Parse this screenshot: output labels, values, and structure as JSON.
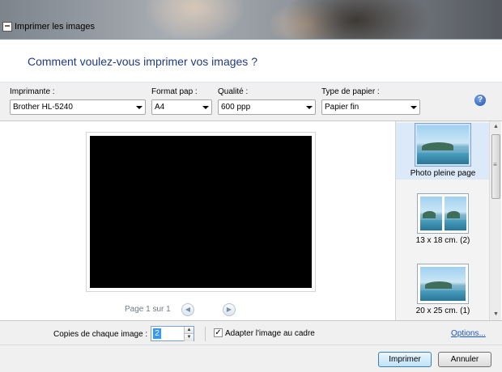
{
  "window": {
    "title": "Imprimer les images",
    "close_glyph": "✕"
  },
  "header": {
    "question": "Comment voulez-vous imprimer vos images ?"
  },
  "options": {
    "printer_label": "Imprimante :",
    "printer_value": "Brother HL-5240",
    "format_label": "Format pap :",
    "format_value": "A4",
    "quality_label": "Qualité :",
    "quality_value": "600 ppp",
    "paper_type_label": "Type de papier :",
    "paper_type_value": "Papier fin",
    "help_glyph": "?"
  },
  "preview": {
    "page_text": "Page 1 sur 1",
    "prev_glyph": "◀",
    "next_glyph": "▶"
  },
  "layouts": [
    {
      "label": "Photo pleine page",
      "selected": true,
      "icon": "landscape-thumbnail-icon"
    },
    {
      "label": "13 x 18 cm. (2)",
      "selected": false,
      "icon": "two-portrait-thumbnail-icon"
    },
    {
      "label": "20 x 25 cm. (1)",
      "selected": false,
      "icon": "landscape-thumbnail-icon"
    }
  ],
  "scrollbar": {
    "up_glyph": "▲",
    "down_glyph": "▼"
  },
  "bottom": {
    "copies_label": "Copies de chaque image :",
    "copies_value": "2",
    "fit_label": "Adapter l'image au cadre",
    "fit_checked": true,
    "check_glyph": "✓",
    "options_link": "Options..."
  },
  "footer": {
    "print_button": "Imprimer",
    "cancel_button": "Annuler"
  }
}
